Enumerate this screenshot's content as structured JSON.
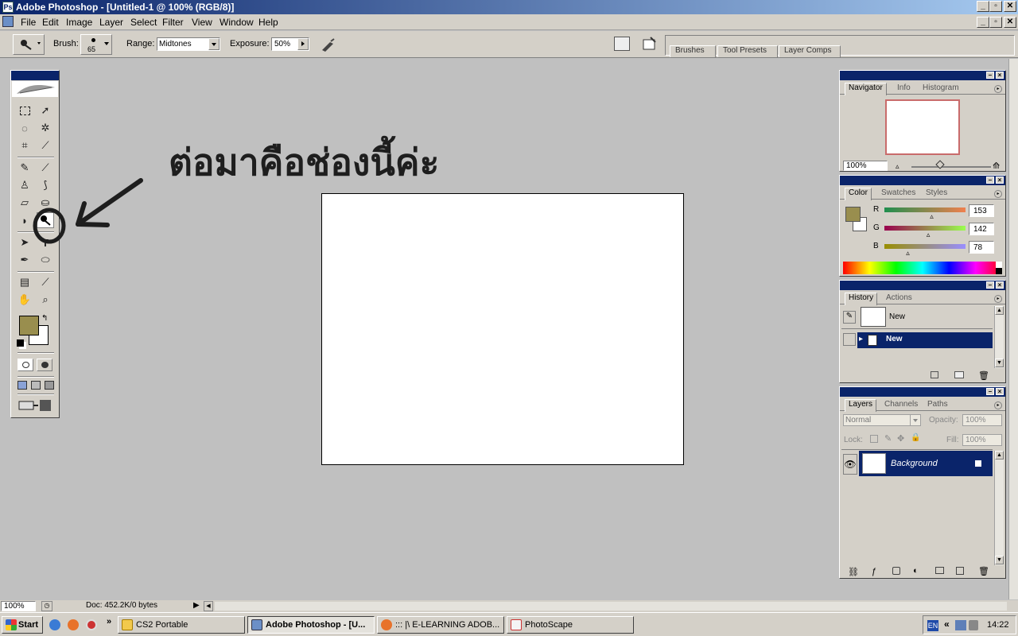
{
  "window": {
    "title": "Adobe Photoshop - [Untitled-1 @ 100% (RGB/8)]",
    "controls": [
      "_",
      "▫",
      "✕"
    ]
  },
  "menu": [
    "File",
    "Edit",
    "Image",
    "Layer",
    "Select",
    "Filter",
    "View",
    "Window",
    "Help"
  ],
  "options": {
    "brush_label": "Brush:",
    "brush_size": "65",
    "range_label": "Range:",
    "range_value": "Midtones",
    "exposure_label": "Exposure:",
    "exposure_value": "50%",
    "palette_well_tabs": [
      "Brushes",
      "Tool Presets",
      "Layer Comps"
    ]
  },
  "annotation": "ต่อมาคือช่องนี้ค่ะ",
  "colors": {
    "foreground": "#998e4e",
    "background": "#ffffff"
  },
  "navigator": {
    "tabs": [
      "Navigator",
      "Info",
      "Histogram"
    ],
    "zoom": "100%"
  },
  "color_panel": {
    "tabs": [
      "Color",
      "Swatches",
      "Styles"
    ],
    "channels": [
      {
        "label": "R",
        "value": "153",
        "fraction": 0.6
      },
      {
        "label": "G",
        "value": "142",
        "fraction": 0.557
      },
      {
        "label": "B",
        "value": "78",
        "fraction": 0.306
      }
    ]
  },
  "history": {
    "tabs": [
      "History",
      "Actions"
    ],
    "snapshot_label": "New",
    "states": [
      "New"
    ]
  },
  "layers": {
    "tabs": [
      "Layers",
      "Channels",
      "Paths"
    ],
    "blend_mode": "Normal",
    "opacity_label": "Opacity:",
    "opacity_value": "100%",
    "lock_label": "Lock:",
    "fill_label": "Fill:",
    "fill_value": "100%",
    "items": [
      "Background"
    ]
  },
  "status": {
    "zoom": "100%",
    "doc_info": "Doc: 452.2K/0 bytes"
  },
  "taskbar": {
    "start": "Start",
    "buttons": [
      "CS2 Portable",
      "Adobe Photoshop - [U...",
      "::: |\\ E-LEARNING ADOB...",
      "PhotoScape"
    ],
    "language": "EN",
    "clock": "14:22"
  }
}
